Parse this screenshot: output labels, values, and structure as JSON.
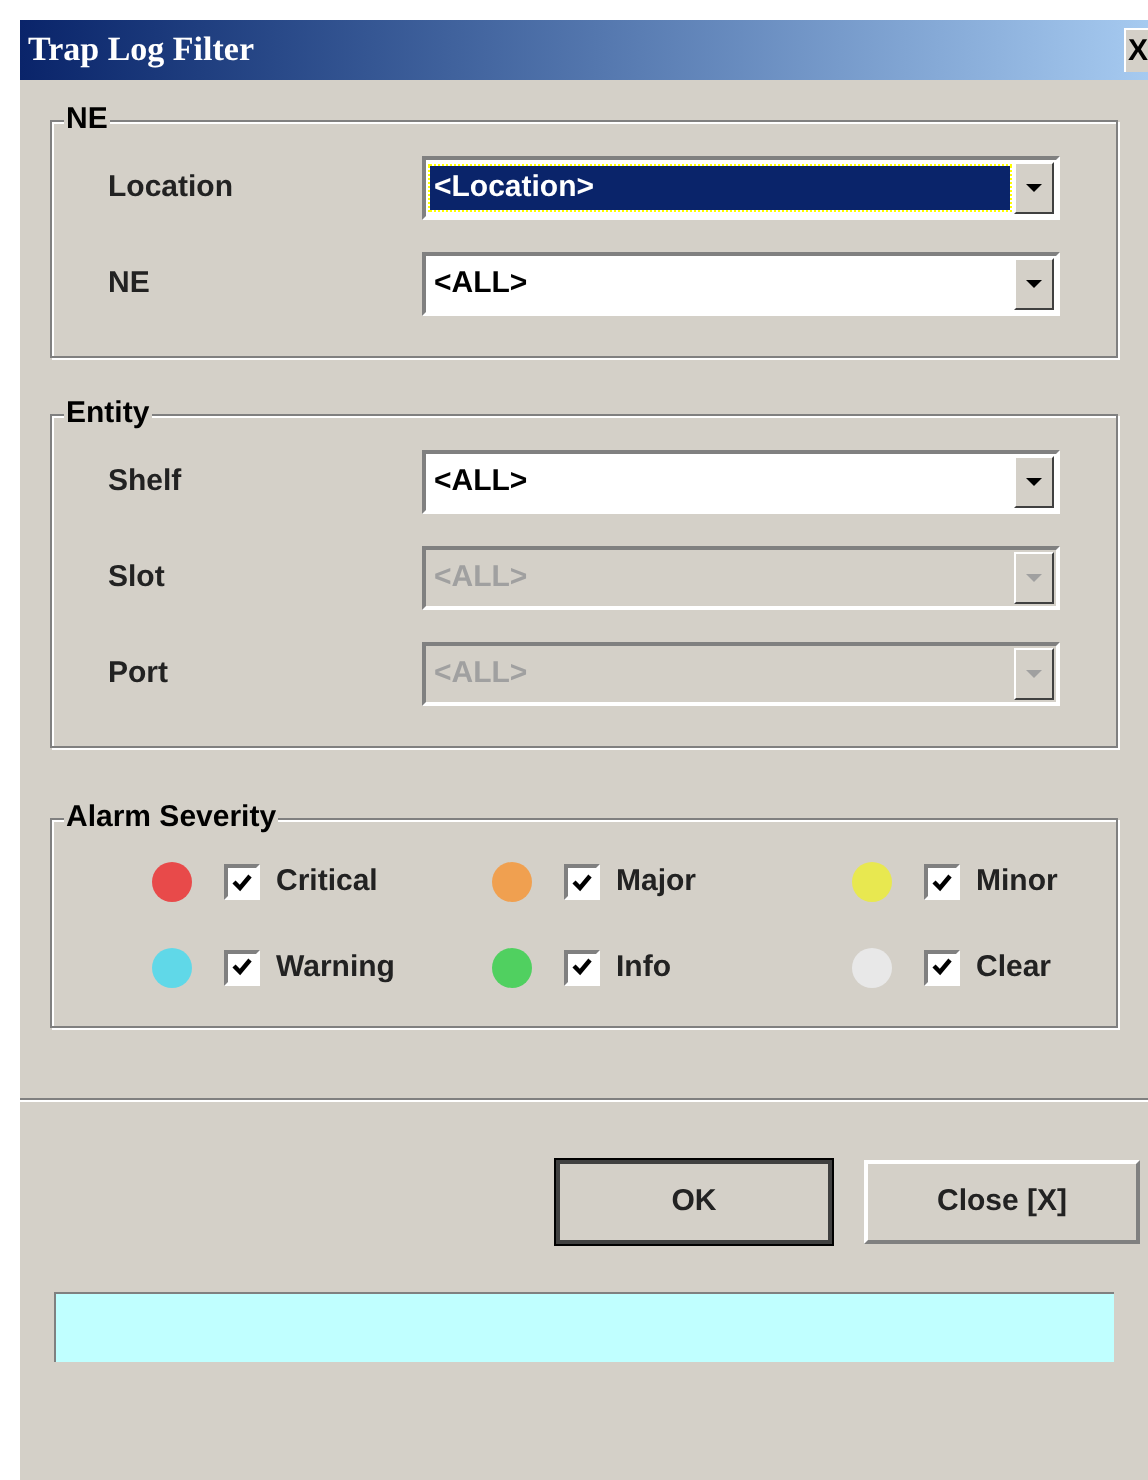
{
  "window": {
    "title": "Trap Log Filter",
    "close": "X"
  },
  "groups": [
    {
      "title": "NE",
      "fields": [
        {
          "label": "Location",
          "value": "<Location>",
          "selected": true,
          "disabled": false
        },
        {
          "label": "NE",
          "value": "<ALL>",
          "selected": false,
          "disabled": false
        }
      ]
    },
    {
      "title": "Entity",
      "fields": [
        {
          "label": "Shelf",
          "value": "<ALL>",
          "selected": false,
          "disabled": false
        },
        {
          "label": "Slot",
          "value": "<ALL>",
          "selected": false,
          "disabled": true
        },
        {
          "label": "Port",
          "value": "<ALL>",
          "selected": false,
          "disabled": true
        }
      ]
    }
  ],
  "alarm_severity": {
    "title": "Alarm Severity",
    "items": [
      {
        "label": "Critical",
        "color": "#e84a4a",
        "checked": true
      },
      {
        "label": "Major",
        "color": "#f0a050",
        "checked": true
      },
      {
        "label": "Minor",
        "color": "#e8e850",
        "checked": true
      },
      {
        "label": "Warning",
        "color": "#60d8e8",
        "checked": true
      },
      {
        "label": "Info",
        "color": "#50d060",
        "checked": true
      },
      {
        "label": "Clear",
        "color": "#e8e8e8",
        "checked": true
      }
    ]
  },
  "buttons": [
    {
      "label": "OK",
      "default": true
    },
    {
      "label": "Close [X]",
      "default": false
    }
  ]
}
